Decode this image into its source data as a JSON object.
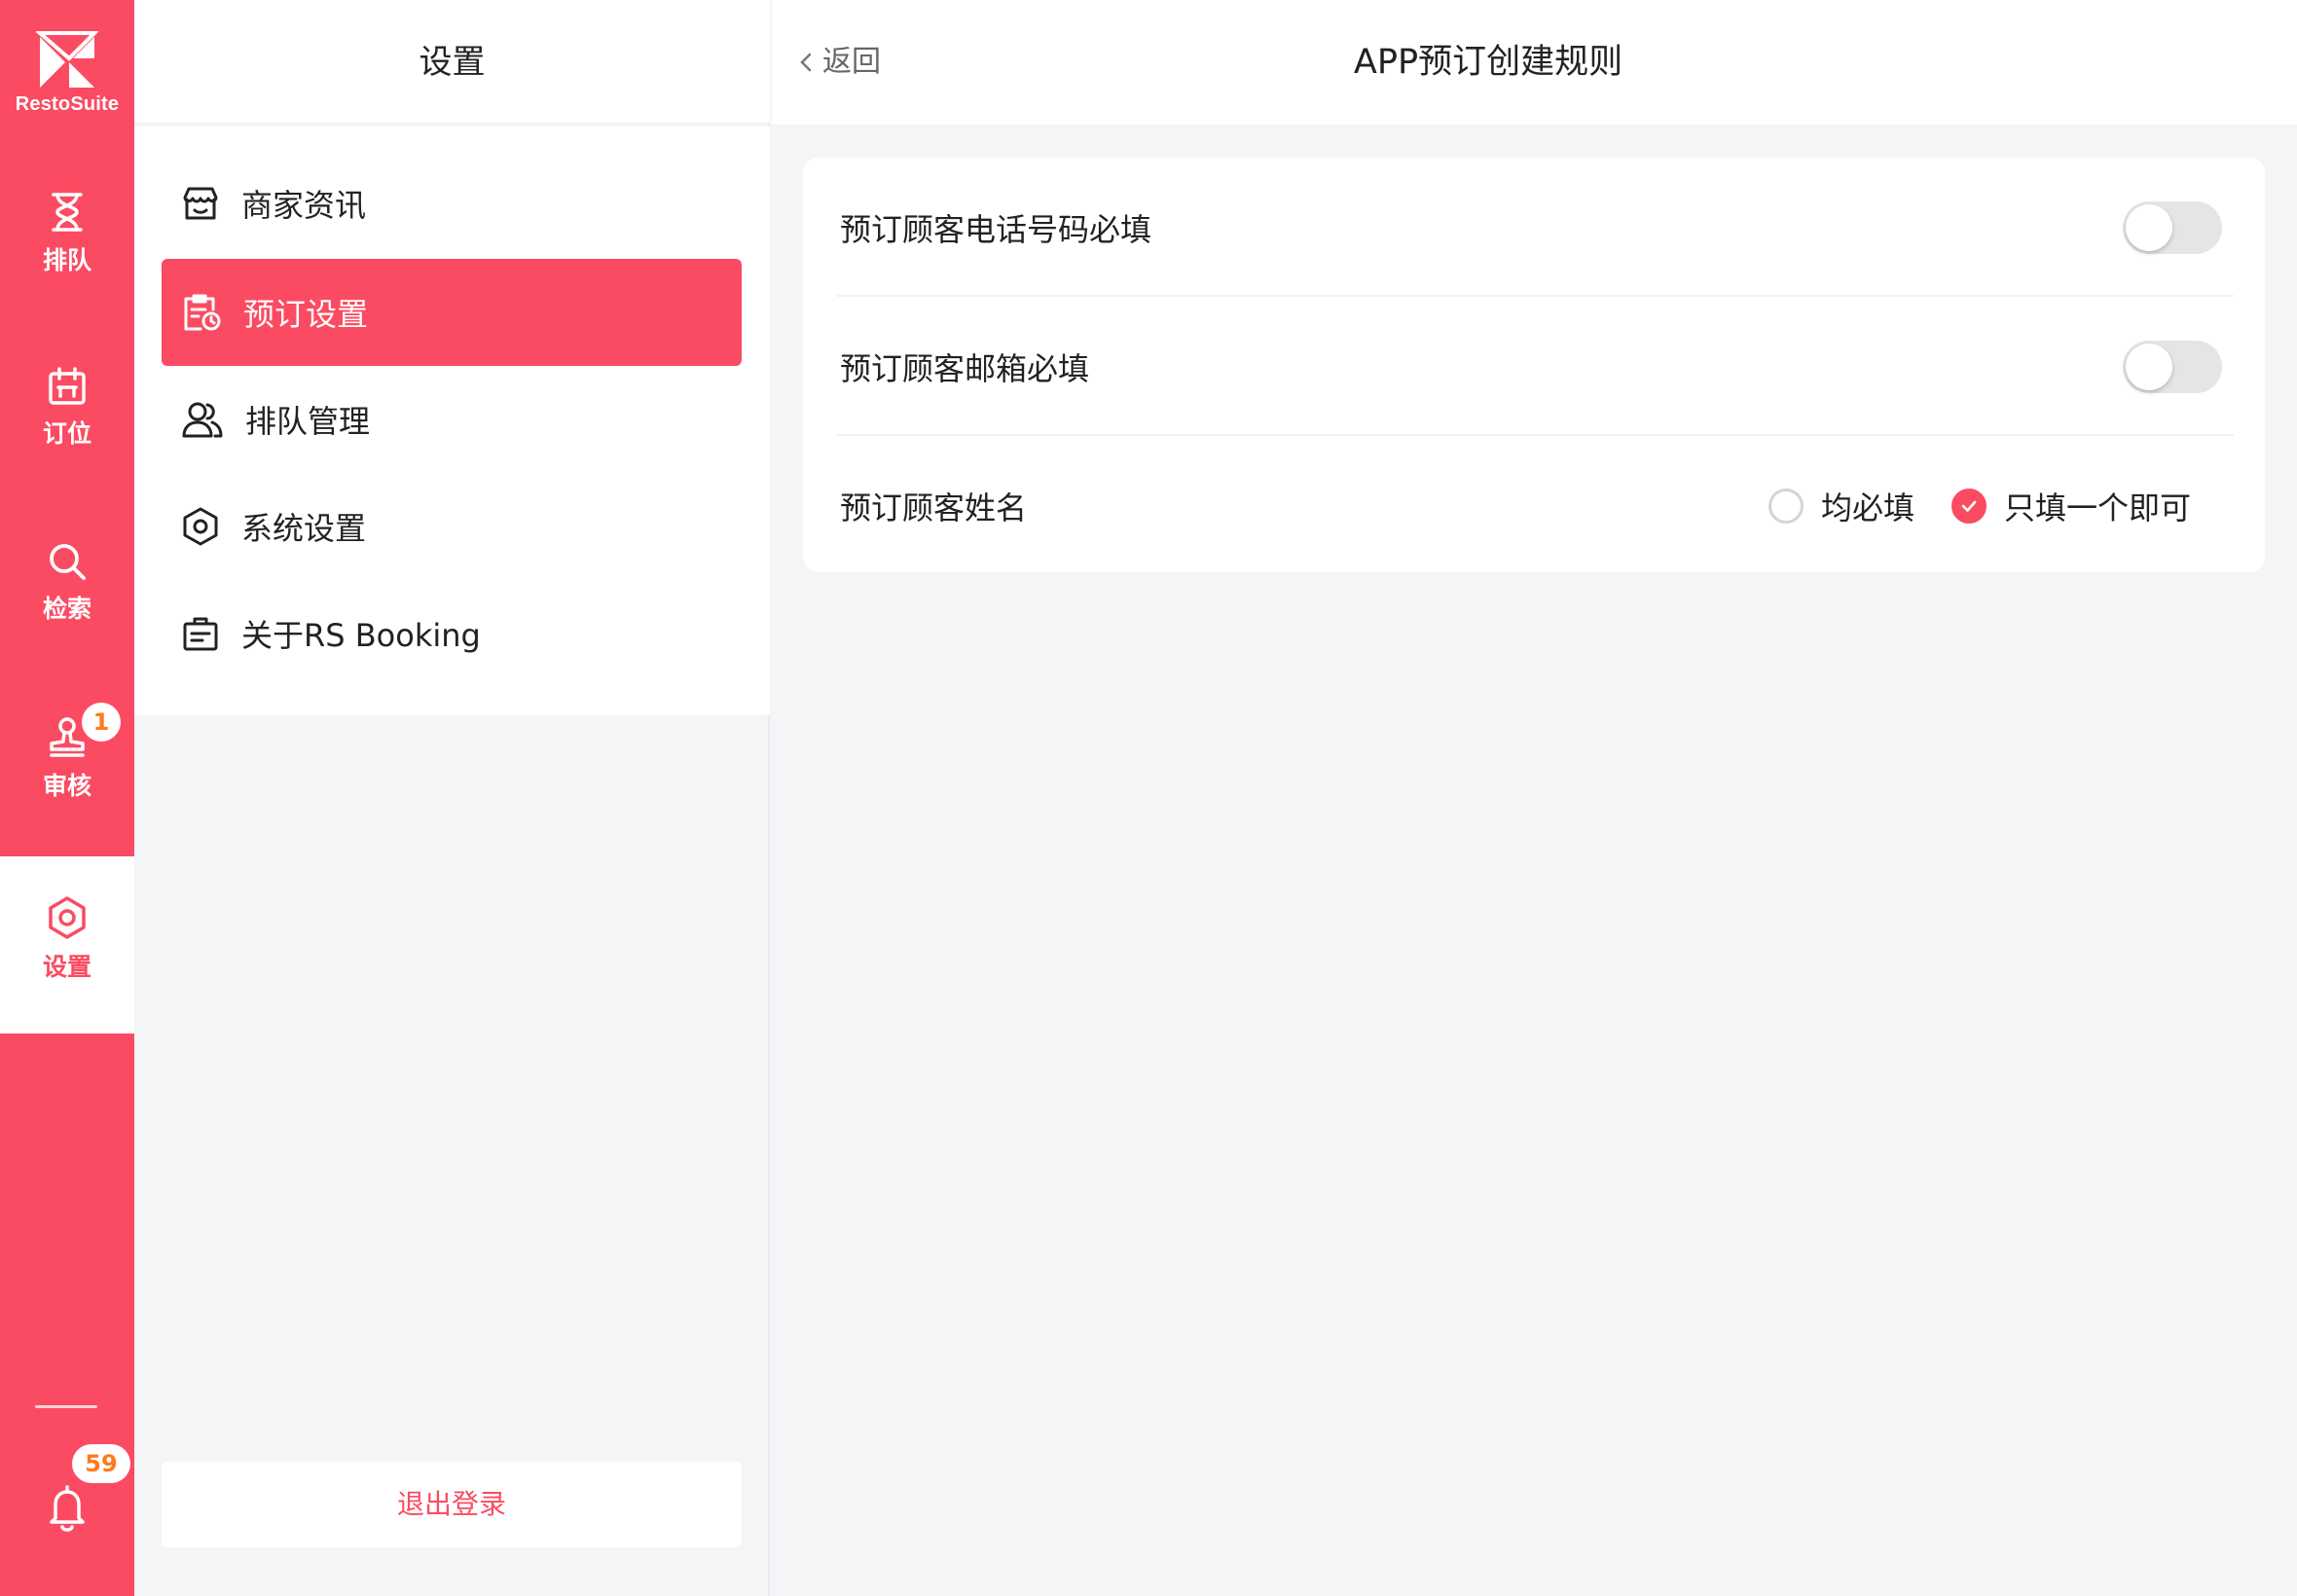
{
  "sidebar": {
    "brand": "RestoSuite",
    "items": [
      {
        "label": "排队",
        "icon": "hourglass-icon"
      },
      {
        "label": "订位",
        "icon": "calendar-icon"
      },
      {
        "label": "检索",
        "icon": "search-icon"
      },
      {
        "label": "审核",
        "icon": "stamp-icon",
        "badge": "1"
      },
      {
        "label": "设置",
        "icon": "settings-icon",
        "active": true
      }
    ],
    "notifications": {
      "icon": "bell-icon",
      "badge": "59"
    }
  },
  "menu": {
    "title": "设置",
    "items": [
      {
        "label": "商家资讯",
        "icon": "store-icon"
      },
      {
        "label": "预订设置",
        "icon": "reservation-settings-icon",
        "active": true
      },
      {
        "label": "排队管理",
        "icon": "users-icon"
      },
      {
        "label": "系统设置",
        "icon": "settings-icon"
      },
      {
        "label": "关于RS Booking",
        "icon": "info-board-icon"
      }
    ],
    "logout_label": "退出登录"
  },
  "content": {
    "back_label": "返回",
    "title": "APP预订创建规则",
    "rules": {
      "phone_required": {
        "label": "预订顾客电话号码必填",
        "enabled": false
      },
      "email_required": {
        "label": "预订顾客邮箱必填",
        "enabled": false
      },
      "name": {
        "label": "预订顾客姓名",
        "options": [
          "均必填",
          "只填一个即可"
        ],
        "selected": "只填一个即可"
      }
    }
  },
  "colors": {
    "accent": "#fb4b62",
    "badge_text": "#ff7a1a",
    "background": "#f4f5f7"
  }
}
